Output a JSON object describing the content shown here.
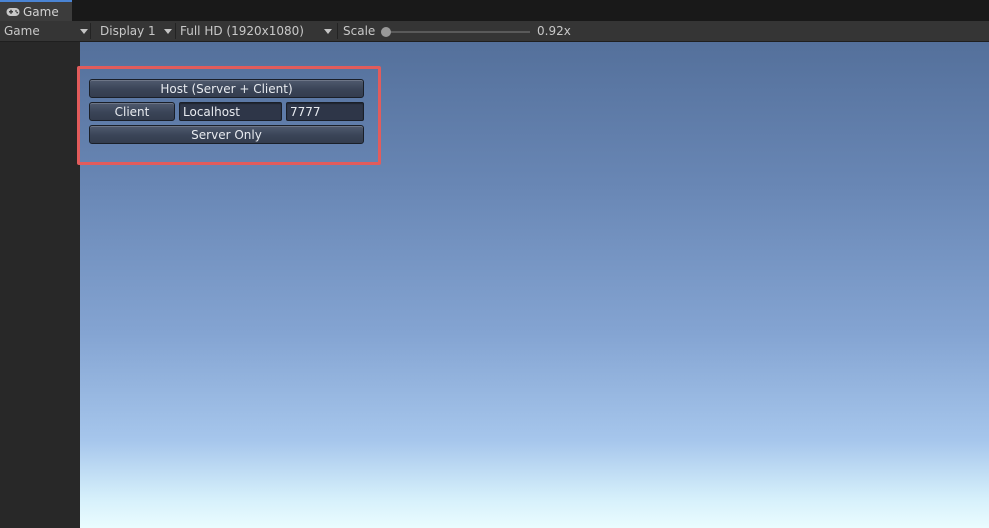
{
  "tab": {
    "label": "Game",
    "icon": "gamepad-icon"
  },
  "toolbar": {
    "mode": "Game",
    "display": "Display 1",
    "resolution": "Full HD (1920x1080)",
    "scale_label": "Scale",
    "scale_value": "0.92x"
  },
  "network_hud": {
    "host_button": "Host (Server + Client)",
    "client_button": "Client",
    "address_value": "Localhost",
    "port_value": "7777",
    "server_button": "Server Only"
  },
  "colors": {
    "highlight": "#e25c5c",
    "tab_accent": "#4a84d4"
  }
}
